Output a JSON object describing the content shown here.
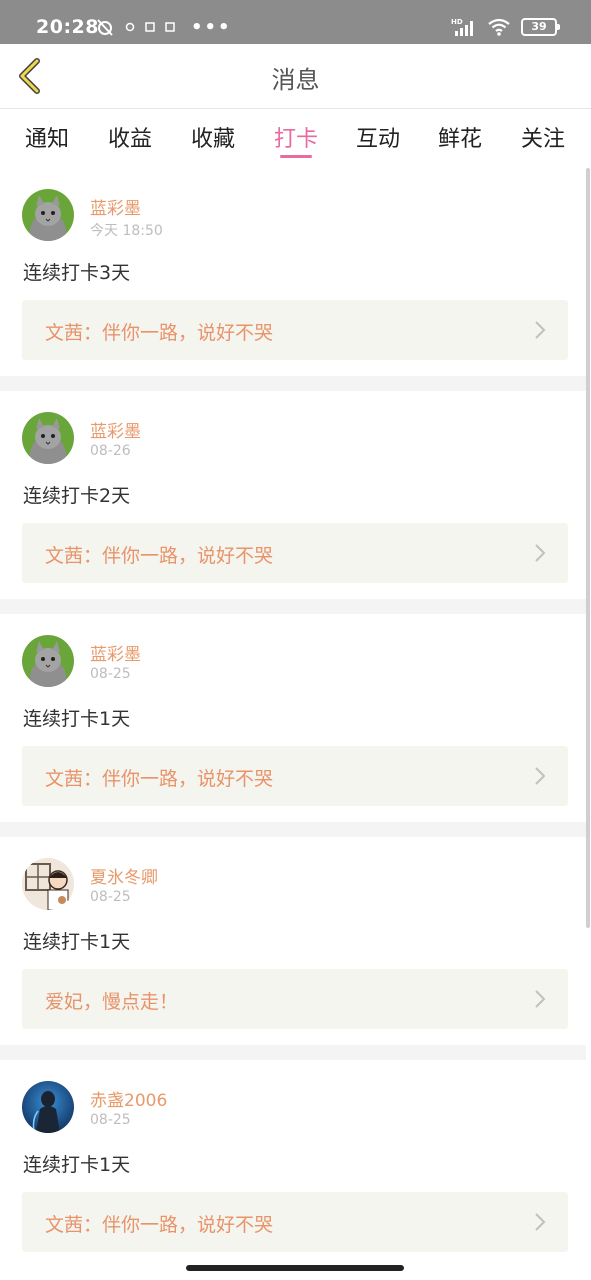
{
  "status_bar": {
    "time": "20:28",
    "battery": "39",
    "icons": [
      "alarm-off-icon",
      "sim-icon",
      "dots-icon",
      "hd-signal-icon",
      "wifi-icon",
      "battery-icon"
    ]
  },
  "nav": {
    "title": "消息",
    "back_icon": "back-chevron-icon"
  },
  "tabs": [
    {
      "label": "通知"
    },
    {
      "label": "收益"
    },
    {
      "label": "收藏"
    },
    {
      "label": "打卡",
      "active": true
    },
    {
      "label": "互动"
    },
    {
      "label": "鲜花"
    },
    {
      "label": "关注"
    }
  ],
  "feed": [
    {
      "username": "蓝彩墨",
      "time": "今天 18:50",
      "content": "连续打卡3天",
      "book": "文茜：伴你一路，说好不哭"
    },
    {
      "username": "蓝彩墨",
      "time": "08-26",
      "content": "连续打卡2天",
      "book": "文茜：伴你一路，说好不哭"
    },
    {
      "username": "蓝彩墨",
      "time": "08-25",
      "content": "连续打卡1天",
      "book": "文茜：伴你一路，说好不哭"
    },
    {
      "username": "夏氷冬卿",
      "time": "08-25",
      "content": "连续打卡1天",
      "book": "爱妃，慢点走！"
    },
    {
      "username": "赤盏2006",
      "time": "08-25",
      "content": "连续打卡1天",
      "book": "文茜：伴你一路，说好不哭"
    }
  ],
  "colors": {
    "accent": "#e86a9f",
    "username": "#e89a6b",
    "book_text": "#e8936a",
    "link_bg": "#f5f5ef",
    "back_icon": "#f0d84a"
  }
}
